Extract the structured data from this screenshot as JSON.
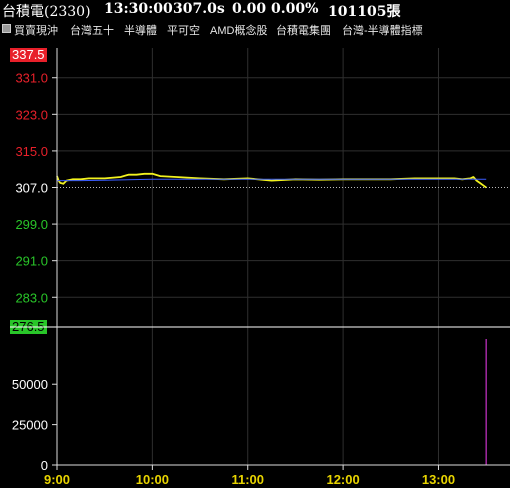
{
  "header": {
    "name": "台積電(2330)",
    "time": "13:30:00",
    "price": "307.0s",
    "change": "0.00",
    "change_pct": "0.00%",
    "volume": "101105張"
  },
  "tags": [
    "買賣現沖",
    "台灣五十",
    "半導體",
    "平可空",
    "AMD概念股",
    "台積電集團",
    "台灣-半導體指標"
  ],
  "colors": {
    "up": "#e8202a",
    "down": "#29c529",
    "ref": "#ffffff",
    "price_line": "#f2f21e",
    "avg_line": "#3a5cff",
    "volume_bar": "#cc33cc",
    "grid": "#2f2f2f",
    "axis_text": "#e8d400"
  },
  "chart_data": {
    "type": "line",
    "title": "",
    "xlabel": "",
    "ylabel": "",
    "x_ticks": [
      "9:00",
      "10:00",
      "11:00",
      "12:00",
      "13:00"
    ],
    "price": {
      "ylim": [
        276.5,
        337.5
      ],
      "reference": 307.0,
      "y_ticks": [
        {
          "value": 337.5,
          "label": "337.5",
          "style": "limit-up"
        },
        {
          "value": 331.0,
          "label": "331.0",
          "style": "up"
        },
        {
          "value": 323.0,
          "label": "323.0",
          "style": "up"
        },
        {
          "value": 315.0,
          "label": "315.0",
          "style": "up"
        },
        {
          "value": 307.0,
          "label": "307.0",
          "style": "ref"
        },
        {
          "value": 299.0,
          "label": "299.0",
          "style": "down"
        },
        {
          "value": 291.0,
          "label": "291.0",
          "style": "down"
        },
        {
          "value": 283.0,
          "label": "283.0",
          "style": "down"
        },
        {
          "value": 276.5,
          "label": "276.5",
          "style": "limit-down"
        }
      ],
      "series": [
        {
          "kind": "price",
          "points": [
            [
              "9:00",
              309.5
            ],
            [
              "9:01",
              308.5
            ],
            [
              "9:02",
              308.0
            ],
            [
              "9:04",
              307.8
            ],
            [
              "9:06",
              308.5
            ],
            [
              "9:10",
              308.8
            ],
            [
              "9:15",
              308.8
            ],
            [
              "9:20",
              309.0
            ],
            [
              "9:30",
              309.0
            ],
            [
              "9:40",
              309.3
            ],
            [
              "9:45",
              309.8
            ],
            [
              "9:50",
              309.8
            ],
            [
              "9:55",
              310.0
            ],
            [
              "10:00",
              310.0
            ],
            [
              "10:05",
              309.5
            ],
            [
              "10:15",
              309.3
            ],
            [
              "10:30",
              309.0
            ],
            [
              "10:45",
              308.8
            ],
            [
              "11:00",
              309.0
            ],
            [
              "11:15",
              308.5
            ],
            [
              "11:30",
              308.8
            ],
            [
              "11:45",
              308.7
            ],
            [
              "12:00",
              308.8
            ],
            [
              "12:15",
              308.8
            ],
            [
              "12:30",
              308.8
            ],
            [
              "12:45",
              309.0
            ],
            [
              "13:00",
              309.0
            ],
            [
              "13:10",
              309.0
            ],
            [
              "13:15",
              308.8
            ],
            [
              "13:20",
              309.0
            ],
            [
              "13:22",
              309.3
            ],
            [
              "13:24",
              308.5
            ],
            [
              "13:26",
              308.0
            ],
            [
              "13:28",
              307.5
            ],
            [
              "13:30",
              307.0
            ]
          ]
        },
        {
          "kind": "average",
          "points": [
            [
              "9:00",
              308.5
            ],
            [
              "9:15",
              308.5
            ],
            [
              "9:30",
              308.6
            ],
            [
              "10:00",
              308.8
            ],
            [
              "10:30",
              308.8
            ],
            [
              "11:00",
              308.8
            ],
            [
              "12:00",
              308.8
            ],
            [
              "13:00",
              308.8
            ],
            [
              "13:30",
              308.8
            ]
          ]
        }
      ]
    },
    "volume": {
      "ylim": [
        0,
        78000
      ],
      "y_ticks": [
        {
          "value": 50000,
          "label": "50000"
        },
        {
          "value": 25000,
          "label": "25000"
        },
        {
          "value": 0,
          "label": "0"
        }
      ],
      "bars": [
        [
          "13:30",
          78000
        ]
      ]
    }
  }
}
